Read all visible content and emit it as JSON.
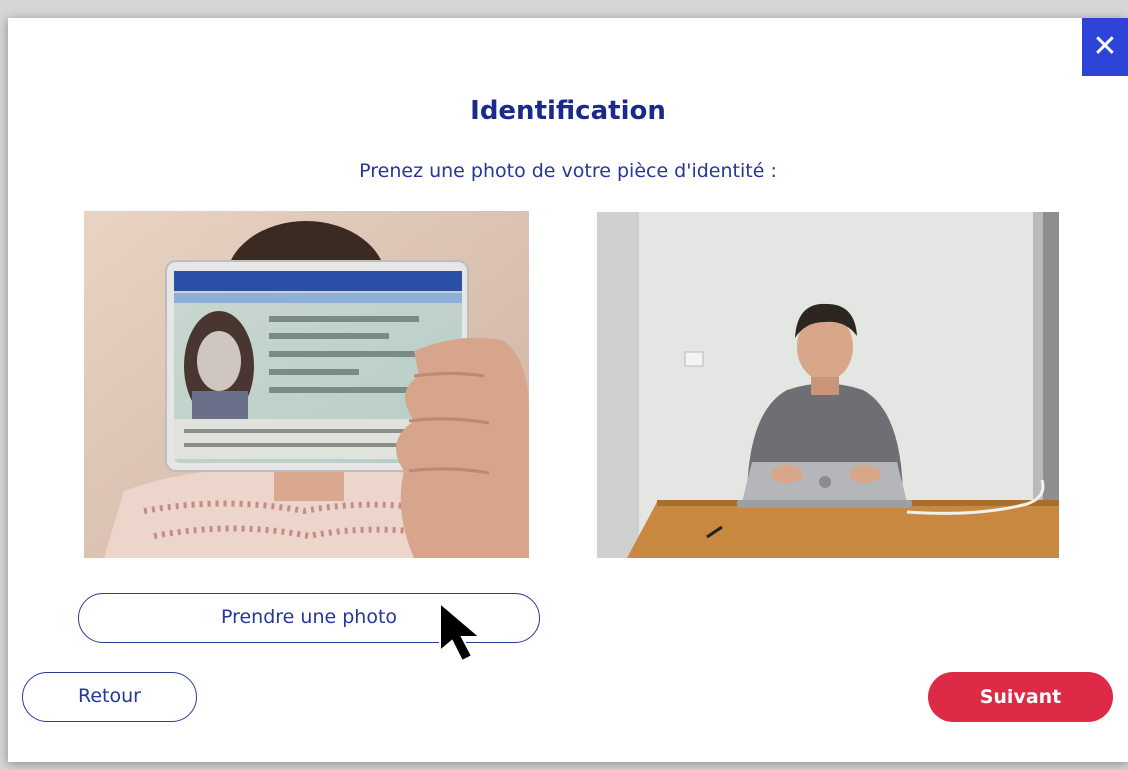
{
  "modal": {
    "title": "Identification",
    "subtitle": "Prenez une photo de votre pièce d'identité :",
    "close_icon": "close-icon",
    "accent_color": "#2c45d8",
    "title_color": "#1a2a8a"
  },
  "photos": {
    "left": "id-card-photo",
    "right": "webcam-feed"
  },
  "buttons": {
    "take_photo_label": "Prendre une photo",
    "back_label": "Retour",
    "next_label": "Suivant",
    "next_color": "#dc2a47"
  },
  "cursor": "mouse-pointer-icon"
}
